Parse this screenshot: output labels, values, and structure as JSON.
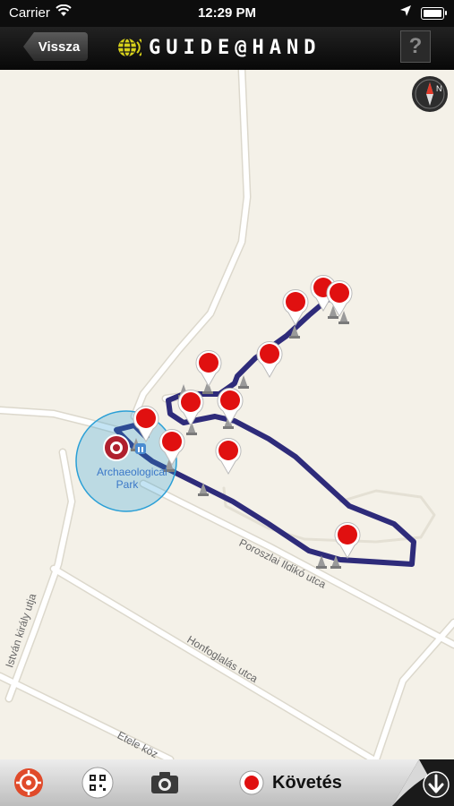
{
  "status_bar": {
    "carrier": "Carrier",
    "time": "12:29 PM"
  },
  "nav": {
    "back_label": "Vissza",
    "logo_text": "GUIDE@HAND",
    "help_label": "?"
  },
  "map": {
    "park_label_line1": "Archaeological",
    "park_label_line2": "Park",
    "streets": [
      {
        "name": "Poroszlai Ildikó utca"
      },
      {
        "name": "Honfoglalás utca"
      },
      {
        "name": "István király utja"
      },
      {
        "name": "Etele köz"
      }
    ],
    "compass_label": "N",
    "route_color": "#2e2b7a",
    "pin_color": "#e01010",
    "location_color": "#2a9fd6"
  },
  "toolbar": {
    "follow_label": "Követés",
    "locate_icon": "target-icon",
    "qr_icon": "qr-code-icon",
    "camera_icon": "camera-icon",
    "download_icon": "download-arrow-icon"
  }
}
